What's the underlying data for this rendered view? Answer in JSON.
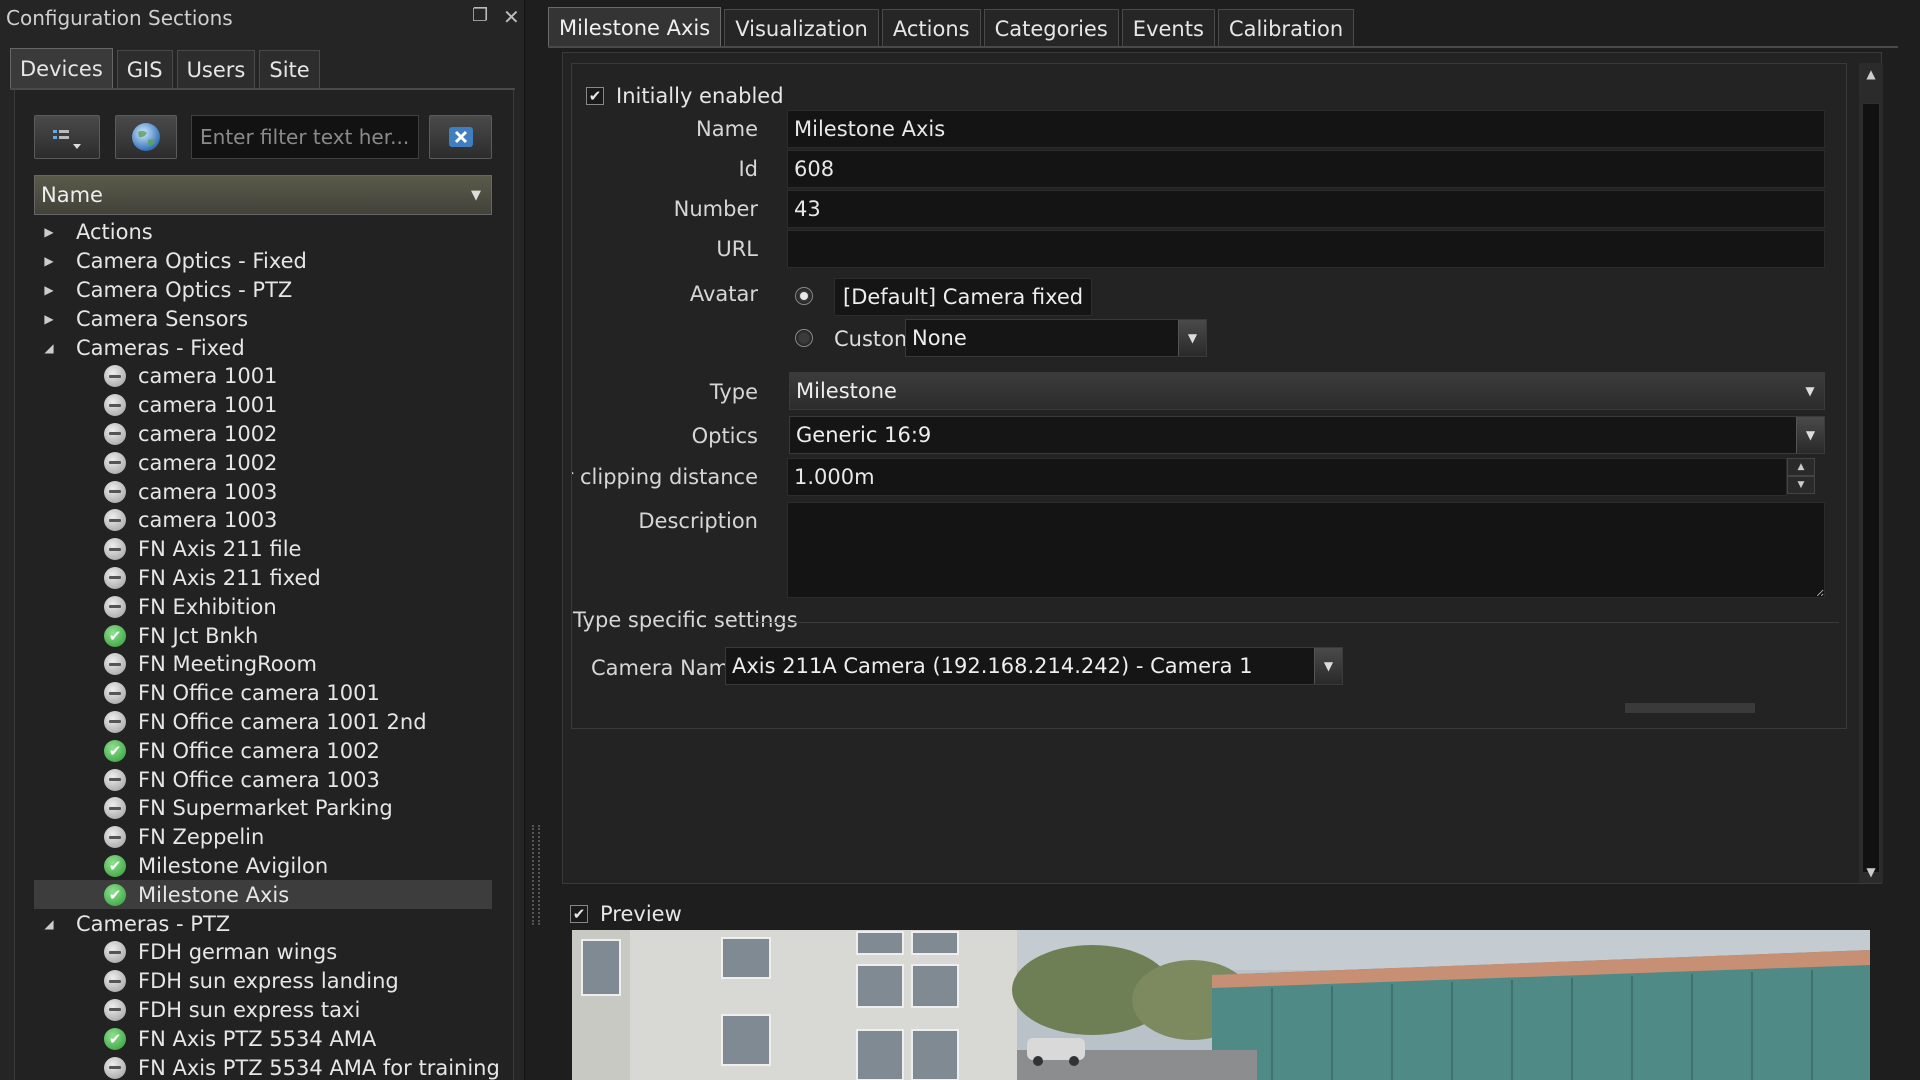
{
  "left_panel": {
    "title": "Configuration Sections",
    "tabs": [
      {
        "label": "Devices",
        "active": true
      },
      {
        "label": "GIS",
        "active": false
      },
      {
        "label": "Users",
        "active": false
      },
      {
        "label": "Site",
        "active": false
      }
    ],
    "filter_placeholder": "Enter filter text her...",
    "tree_header": "Name",
    "tree": [
      {
        "kind": "cat",
        "label": "Actions",
        "expanded": false
      },
      {
        "kind": "cat",
        "label": "Camera Optics - Fixed",
        "expanded": false
      },
      {
        "kind": "cat",
        "label": "Camera Optics - PTZ",
        "expanded": false
      },
      {
        "kind": "cat",
        "label": "Camera Sensors",
        "expanded": false
      },
      {
        "kind": "cat",
        "label": "Cameras - Fixed",
        "expanded": true
      },
      {
        "kind": "leaf",
        "label": "camera 1001",
        "status": "grey"
      },
      {
        "kind": "leaf",
        "label": "camera 1001",
        "status": "grey"
      },
      {
        "kind": "leaf",
        "label": "camera 1002",
        "status": "grey"
      },
      {
        "kind": "leaf",
        "label": "camera 1002",
        "status": "grey"
      },
      {
        "kind": "leaf",
        "label": "camera 1003",
        "status": "grey"
      },
      {
        "kind": "leaf",
        "label": "camera 1003",
        "status": "grey"
      },
      {
        "kind": "leaf",
        "label": "FN Axis 211 file",
        "status": "grey"
      },
      {
        "kind": "leaf",
        "label": "FN Axis 211 fixed",
        "status": "grey"
      },
      {
        "kind": "leaf",
        "label": "FN Exhibition",
        "status": "grey"
      },
      {
        "kind": "leaf",
        "label": "FN Jct Bnkh",
        "status": "green"
      },
      {
        "kind": "leaf",
        "label": "FN MeetingRoom",
        "status": "grey"
      },
      {
        "kind": "leaf",
        "label": "FN Office camera 1001",
        "status": "grey"
      },
      {
        "kind": "leaf",
        "label": "FN Office camera 1001 2nd",
        "status": "grey"
      },
      {
        "kind": "leaf",
        "label": "FN Office camera 1002",
        "status": "green"
      },
      {
        "kind": "leaf",
        "label": "FN Office camera 1003",
        "status": "grey"
      },
      {
        "kind": "leaf",
        "label": "FN Supermarket Parking",
        "status": "grey"
      },
      {
        "kind": "leaf",
        "label": "FN Zeppelin",
        "status": "grey"
      },
      {
        "kind": "leaf",
        "label": "Milestone Avigilon",
        "status": "green"
      },
      {
        "kind": "leaf",
        "label": "Milestone Axis",
        "status": "green",
        "selected": true
      },
      {
        "kind": "cat",
        "label": "Cameras - PTZ",
        "expanded": true
      },
      {
        "kind": "leaf",
        "label": "FDH german wings",
        "status": "grey"
      },
      {
        "kind": "leaf",
        "label": "FDH sun express landing",
        "status": "grey"
      },
      {
        "kind": "leaf",
        "label": "FDH sun express taxi",
        "status": "grey"
      },
      {
        "kind": "leaf",
        "label": "FN Axis PTZ 5534 AMA",
        "status": "green"
      },
      {
        "kind": "leaf",
        "label": "FN Axis PTZ 5534 AMA for training",
        "status": "grey"
      }
    ]
  },
  "right_panel": {
    "tabs": [
      {
        "label": "Milestone Axis",
        "active": true
      },
      {
        "label": "Visualization",
        "active": false
      },
      {
        "label": "Actions",
        "active": false
      },
      {
        "label": "Categories",
        "active": false
      },
      {
        "label": "Events",
        "active": false
      },
      {
        "label": "Calibration",
        "active": false
      }
    ],
    "initially_enabled_label": "Initially enabled",
    "initially_enabled_checked": true,
    "name_label": "Name",
    "name_value": "Milestone Axis",
    "id_label": "Id",
    "id_value": "608",
    "number_label": "Number",
    "number_value": "43",
    "url_label": "URL",
    "url_value": "",
    "avatar_label": "Avatar",
    "avatar_default": "[Default] Camera fixed",
    "avatar_custom_label": "Custom",
    "avatar_custom_value": "None",
    "type_label": "Type",
    "type_value": "Milestone",
    "optics_label": "Optics",
    "optics_value": "Generic 16:9",
    "near_clip_label": "Near clipping distance",
    "near_clip_value": "1.000m",
    "description_label": "Description",
    "type_specific_title": "Type specific settings",
    "camera_name_label": "Camera Name",
    "camera_name_value": "Axis 211A Camera (192.168.214.242) - Camera 1",
    "preview_label": "Preview",
    "preview_checked": true
  },
  "colors": {
    "background": "#1e1e1e",
    "panel": "#252525",
    "field": "#141414",
    "status_green": "#2e9a35",
    "text": "#e6e6e6"
  }
}
